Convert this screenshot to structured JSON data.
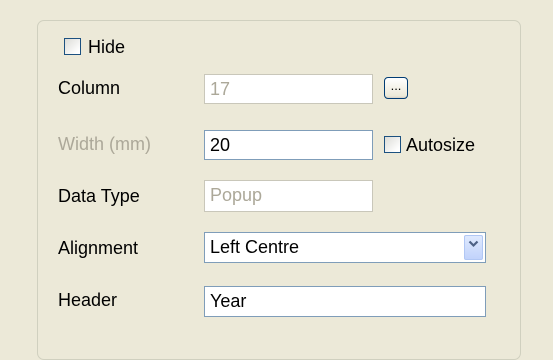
{
  "hide": {
    "label": "Hide",
    "checked": false
  },
  "column": {
    "label": "Column",
    "value": "17",
    "browse_label": "..."
  },
  "width": {
    "label": "Width (mm)",
    "value": "20"
  },
  "autosize": {
    "label": "Autosize",
    "checked": false
  },
  "data_type": {
    "label": "Data Type",
    "value": "Popup"
  },
  "alignment": {
    "label": "Alignment",
    "value": "Left Centre"
  },
  "header": {
    "label": "Header",
    "value": "Year"
  },
  "icons": {
    "dropdown": "chevron-down-icon"
  },
  "colors": {
    "background": "#ece9d8",
    "field_border": "#7f9db9",
    "disabled_text": "#aca899",
    "checkbox_border": "#1c5180"
  }
}
